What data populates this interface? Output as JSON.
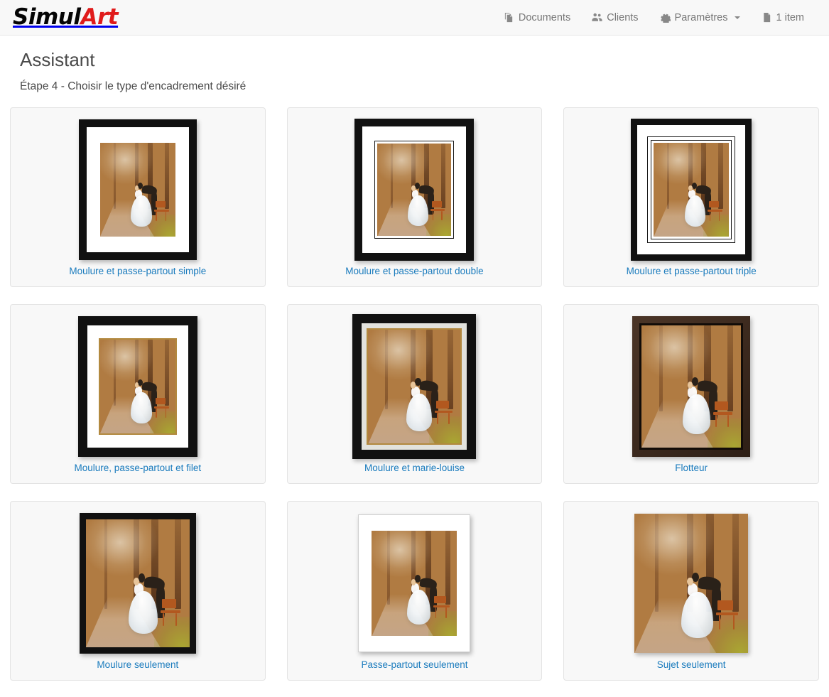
{
  "brand": {
    "part1": "Simul",
    "part2": "Art"
  },
  "nav": {
    "items": [
      {
        "label": "Documents",
        "icon": "documents-icon"
      },
      {
        "label": "Clients",
        "icon": "users-icon"
      },
      {
        "label": "Paramètres",
        "icon": "gear-icon",
        "caret": true
      },
      {
        "label": "1 item",
        "icon": "file-icon"
      }
    ]
  },
  "page": {
    "title": "Assistant",
    "subtitle": "Étape 4 - Choisir le type d'encadrement désiré"
  },
  "options": [
    {
      "label": "Moulure et passe-partout simple"
    },
    {
      "label": "Moulure et passe-partout double"
    },
    {
      "label": "Moulure et passe-partout triple"
    },
    {
      "label": "Moulure, passe-partout et filet"
    },
    {
      "label": "Moulure et marie-louise"
    },
    {
      "label": "Flotteur"
    },
    {
      "label": "Moulure seulement"
    },
    {
      "label": "Passe-partout seulement"
    },
    {
      "label": "Sujet seulement"
    }
  ],
  "colors": {
    "link": "#1a7bbd",
    "brand_accent": "#e01b1b",
    "navbar_bg": "#f8f8f8",
    "card_bg": "#f8f8f8",
    "card_border": "#e3e3e3",
    "frame_black": "#111111",
    "frame_wood": "#3d2b20",
    "mat_white": "#ffffff",
    "fillet_gold": "#b2893f",
    "marie_louise": "#e2e2dd"
  }
}
